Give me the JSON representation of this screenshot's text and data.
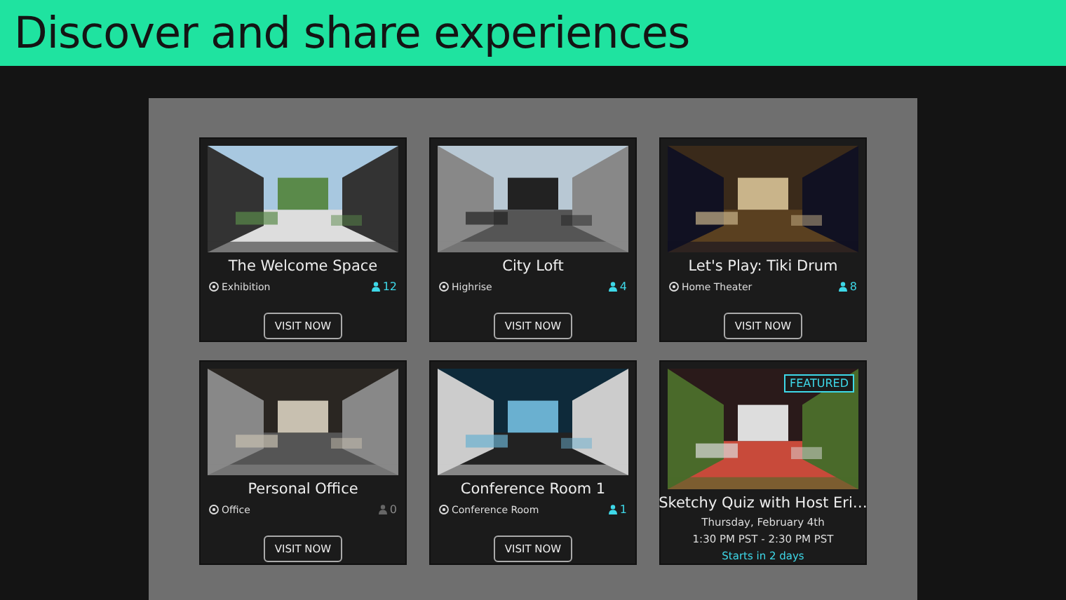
{
  "header": {
    "title": "Discover and share experiences"
  },
  "cards": [
    {
      "kind": "space",
      "title": "The Welcome Space",
      "category": "Exhibition",
      "count": "12",
      "occupied": true,
      "button": "VISIT NOW"
    },
    {
      "kind": "space",
      "title": "City Loft",
      "category": "Highrise",
      "count": "4",
      "occupied": true,
      "button": "VISIT NOW"
    },
    {
      "kind": "space",
      "title": "Let's Play: Tiki Drum",
      "category": "Home Theater",
      "count": "8",
      "occupied": true,
      "button": "VISIT NOW"
    },
    {
      "kind": "space",
      "title": "Personal Office",
      "category": "Office",
      "count": "0",
      "occupied": false,
      "button": "VISIT NOW"
    },
    {
      "kind": "space",
      "title": "Conference Room 1",
      "category": "Conference Room",
      "count": "1",
      "occupied": true,
      "button": "VISIT NOW"
    },
    {
      "kind": "event",
      "title": "Sketchy Quiz with Host Eri…",
      "badge": "FEATURED",
      "date": "Thursday, February 4th",
      "time": "1:30 PM PST - 2:30 PM PST",
      "starts": "Starts in 2 days"
    }
  ]
}
